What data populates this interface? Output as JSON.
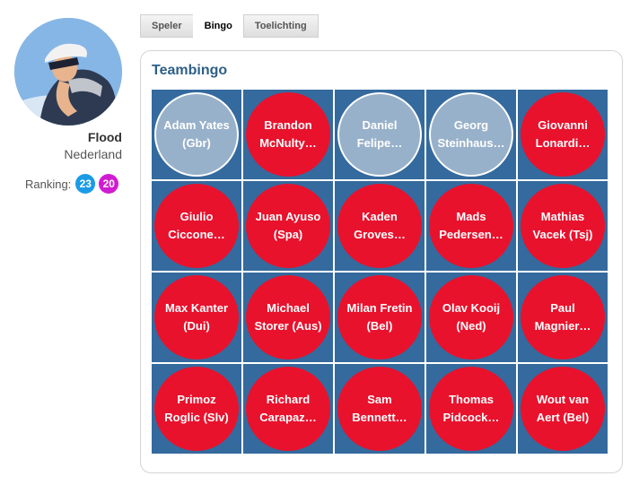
{
  "profile": {
    "name": "Flood",
    "country": "Nederland",
    "ranking_label": "Ranking:",
    "ranking_badges": [
      "23",
      "20"
    ]
  },
  "tabs": [
    {
      "label": "Speler",
      "active": false
    },
    {
      "label": "Bingo",
      "active": true
    },
    {
      "label": "Toelichting",
      "active": false
    }
  ],
  "panel": {
    "title": "Teambingo"
  },
  "bingo": {
    "cells": [
      {
        "line1": "Adam Yates",
        "line2": "(Gbr)",
        "state": "done"
      },
      {
        "line1": "Brandon",
        "line2": "McNulty…",
        "state": "red"
      },
      {
        "line1": "Daniel",
        "line2": "Felipe…",
        "state": "done"
      },
      {
        "line1": "Georg",
        "line2": "Steinhaus…",
        "state": "done"
      },
      {
        "line1": "Giovanni",
        "line2": "Lonardi…",
        "state": "red"
      },
      {
        "line1": "Giulio",
        "line2": "Ciccone…",
        "state": "red"
      },
      {
        "line1": "Juan Ayuso",
        "line2": "(Spa)",
        "state": "red"
      },
      {
        "line1": "Kaden",
        "line2": "Groves…",
        "state": "red"
      },
      {
        "line1": "Mads",
        "line2": "Pedersen…",
        "state": "red"
      },
      {
        "line1": "Mathias",
        "line2": "Vacek (Tsj)",
        "state": "red"
      },
      {
        "line1": "Max Kanter",
        "line2": "(Dui)",
        "state": "red"
      },
      {
        "line1": "Michael",
        "line2": "Storer (Aus)",
        "state": "red"
      },
      {
        "line1": "Milan Fretin",
        "line2": "(Bel)",
        "state": "red"
      },
      {
        "line1": "Olav Kooij",
        "line2": "(Ned)",
        "state": "red"
      },
      {
        "line1": "Paul",
        "line2": "Magnier…",
        "state": "red"
      },
      {
        "line1": "Primoz",
        "line2": "Roglic (Slv)",
        "state": "red"
      },
      {
        "line1": "Richard",
        "line2": "Carapaz…",
        "state": "red"
      },
      {
        "line1": "Sam",
        "line2": "Bennett…",
        "state": "red"
      },
      {
        "line1": "Thomas",
        "line2": "Pidcock…",
        "state": "red"
      },
      {
        "line1": "Wout van",
        "line2": "Aert (Bel)",
        "state": "red"
      }
    ]
  },
  "colors": {
    "cell_bg": "#346a9e",
    "pending": "#e8122d",
    "done": "#98b1ca",
    "title": "#2e5f86"
  }
}
